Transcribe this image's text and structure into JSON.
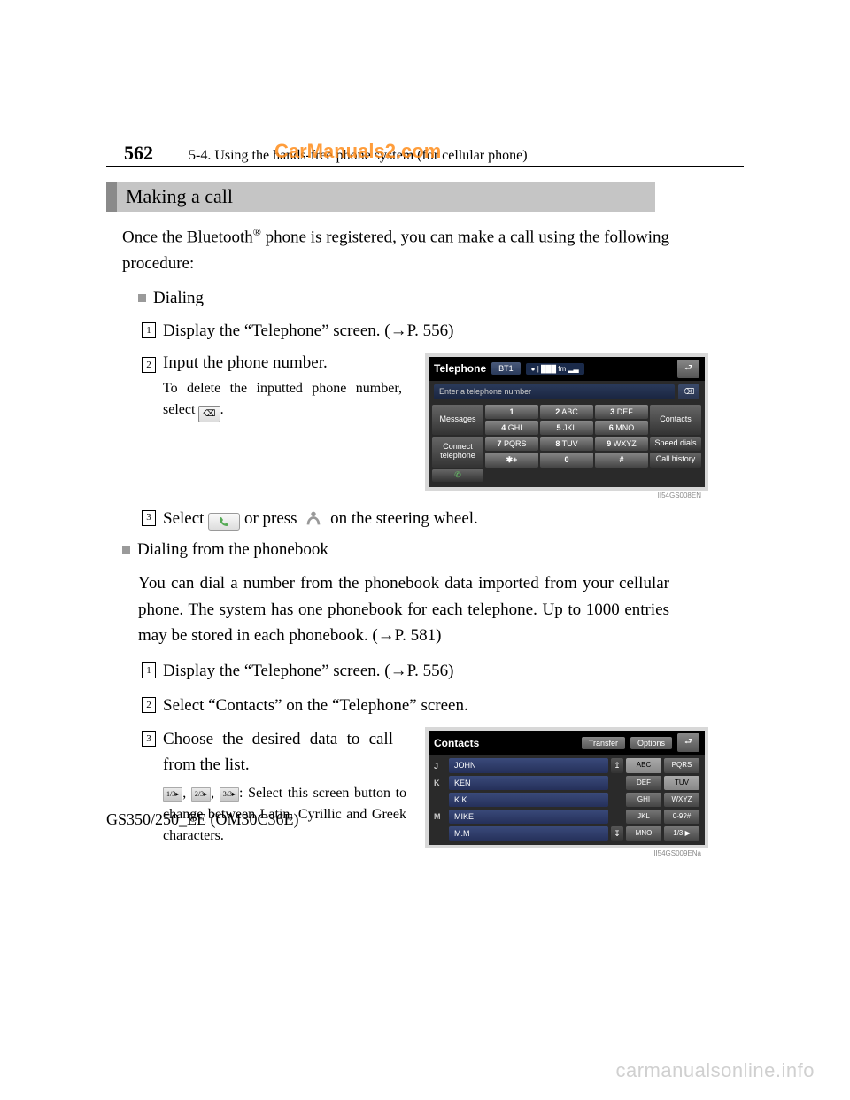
{
  "header": {
    "page_number": "562",
    "chapter": "5-4. Using the hands-free phone system (for cellular phone)",
    "watermark": "CarManuals2.com"
  },
  "section_title": "Making a call",
  "intro": "Once the Bluetooth® phone is registered, you can make a call using the following procedure:",
  "dialing": {
    "heading": "Dialing",
    "step1": "Display the “Telephone” screen. (→P. 556)",
    "step2": "Input the phone number.",
    "step2_note_a": "To delete the inputted phone number, select ",
    "step2_note_b": ".",
    "step3_a": "Select ",
    "step3_b": " or press ",
    "step3_c": " on the steering wheel."
  },
  "phonebook": {
    "heading": "Dialing from the phonebook",
    "para": "You can dial a number from the phonebook data imported from your cellular phone. The system has one phonebook for each telephone. Up to 1000 entries may be stored in each phonebook. (→P. 581)",
    "step1": "Display the “Telephone” screen. (→P. 556)",
    "step2": "Select “Contacts” on the “Telephone” screen.",
    "step3": "Choose the desired data to call from the list.",
    "step3_note": ": Select this screen button to change between Latin, Cyrillic and Greek characters."
  },
  "telephone_screen": {
    "title": "Telephone",
    "bt": "BT1",
    "signal": "● | ███ fm  ▂▃",
    "entry_placeholder": "Enter a telephone number",
    "side_left": [
      "Messages",
      "Connect telephone"
    ],
    "side_right": [
      "Contacts",
      "Speed dials",
      "Call history"
    ],
    "keys": [
      [
        "1",
        ""
      ],
      [
        "2",
        "ABC"
      ],
      [
        "3",
        "DEF"
      ],
      [
        "4",
        "GHI"
      ],
      [
        "5",
        "JKL"
      ],
      [
        "6",
        "MNO"
      ],
      [
        "7",
        "PQRS"
      ],
      [
        "8",
        "TUV"
      ],
      [
        "9",
        "WXYZ"
      ],
      [
        "*+",
        ""
      ],
      [
        "0",
        ""
      ],
      [
        "#",
        ""
      ]
    ],
    "caption": "II54GS008EN"
  },
  "contacts_screen": {
    "title": "Contacts",
    "transfer": "Transfer",
    "options": "Options",
    "rows": [
      {
        "letter": "J",
        "name": "JOHN"
      },
      {
        "letter": "K",
        "name": "KEN"
      },
      {
        "letter": "",
        "name": "K.K"
      },
      {
        "letter": "M",
        "name": "MIKE"
      },
      {
        "letter": "",
        "name": "M.M"
      }
    ],
    "alpha_left": [
      "ABC",
      "DEF",
      "GHI",
      "JKL",
      "MNO"
    ],
    "alpha_right": [
      "PQRS",
      "TUV",
      "WXYZ",
      "0-9?#",
      "1/3 ▶"
    ],
    "caption": "II54GS009ENa"
  },
  "cyc_buttons": [
    "1/3▸",
    "2/3▸",
    "3/3▸"
  ],
  "footer": "GS350/250_EE (OM30C36E)",
  "bottom_watermark": "carmanualsonline.info"
}
